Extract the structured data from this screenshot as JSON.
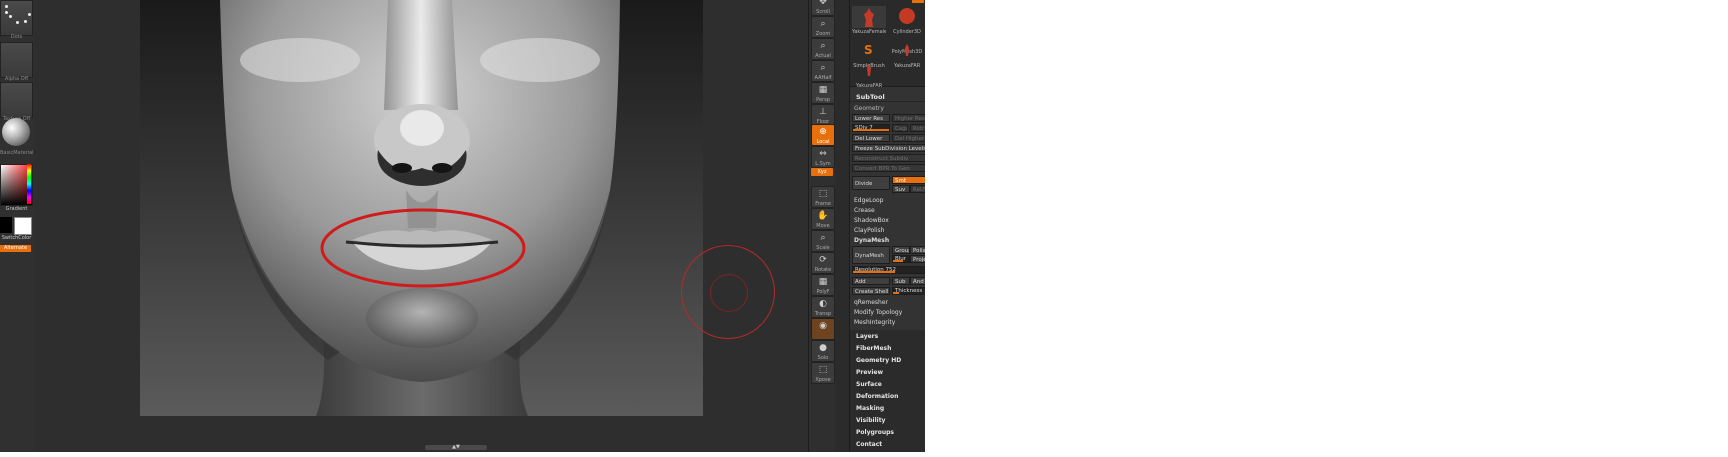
{
  "left_shelf": {
    "brush_caption": "Dots",
    "alpha_caption": "Alpha Off",
    "texture_caption": "Texture Off",
    "material_caption": "BasicMaterial",
    "gradient_label": "Gradient",
    "switch_color_label": "SwitchColor",
    "alternate_label": "Alternate"
  },
  "canvas": {
    "scroll_handle_label": "▲▼",
    "annotation_color": "#d11a1a",
    "cursor_color": "#b52a2a"
  },
  "right_shelf": {
    "buttons": [
      {
        "label": "Scroll",
        "icon": "scroll-icon"
      },
      {
        "label": "Zoom",
        "icon": "zoom-icon"
      },
      {
        "label": "Actual",
        "icon": "actual-icon"
      },
      {
        "label": "AAHalf",
        "icon": "aahalf-icon"
      },
      {
        "label": "Persp",
        "icon": "persp-icon"
      },
      {
        "label": "Floor",
        "icon": "floor-icon"
      },
      {
        "label": "Local",
        "icon": "local-icon"
      },
      {
        "label": "L.Sym",
        "icon": "lsym-icon"
      },
      {
        "label": "Xyz",
        "icon": "xyz-icon"
      },
      {
        "label": "Frame",
        "icon": "frame-icon"
      },
      {
        "label": "Move",
        "icon": "move-icon"
      },
      {
        "label": "Scale",
        "icon": "scale-icon"
      },
      {
        "label": "Rotate",
        "icon": "rotate-icon"
      },
      {
        "label": "PolyF",
        "icon": "polyf-icon"
      },
      {
        "label": "Transp",
        "icon": "transp-icon"
      },
      {
        "label": "Solo",
        "icon": "solo-icon"
      },
      {
        "label": "Xpose",
        "icon": "xpose-icon"
      }
    ]
  },
  "tool_panel": {
    "thumbs": [
      {
        "label": "YakuzaFemale"
      },
      {
        "label": "Cylinder3D"
      },
      {
        "label": "PolyMesh3D"
      },
      {
        "label": "SimpleBrush"
      },
      {
        "label": "YakuzaFAR"
      },
      {
        "label": "YakuzaFAR"
      }
    ],
    "subtool": "SubTool",
    "geometry": "Geometry",
    "lower_res": "Lower Res",
    "higher_res": "Higher Res",
    "sdiv": "SDiv 7",
    "cage": "Cage",
    "rstr": "Rstr",
    "del_lower": "Del Lower",
    "del_higher": "Del Higher",
    "freeze_subdiv": "Freeze SubDivision Levels",
    "reconstruct_subdiv": "Reconstruct Subdiv",
    "convert_bpr": "Convert BPR To Geo",
    "divide": "Divide",
    "smt": "Smt",
    "suv": "Suv",
    "rsuv": "ReUV",
    "edgeloop": "EdgeLoop",
    "crease": "Crease",
    "shadowbox": "ShadowBox",
    "claypolish": "ClayPolish",
    "dynamesh_head": "DynaMesh",
    "dynamesh_btn": "DynaMesh",
    "group": "Group",
    "polish": "Polish",
    "blur": "Blur",
    "project": "Project",
    "resolution": "Resolution 752",
    "resolution_value": 752,
    "add": "Add",
    "sub": "Sub",
    "and": "And",
    "create_shell": "Create Shell",
    "thickness": "Thickness",
    "qremesher": "qRemesher",
    "modify_topology": "Modify Topology",
    "meshintegrity": "MeshIntegrity",
    "bottom_sections": [
      "Layers",
      "FiberMesh",
      "Geometry HD",
      "Preview",
      "Surface",
      "Deformation",
      "Masking",
      "Visibility",
      "Polygroups",
      "Contact"
    ]
  }
}
